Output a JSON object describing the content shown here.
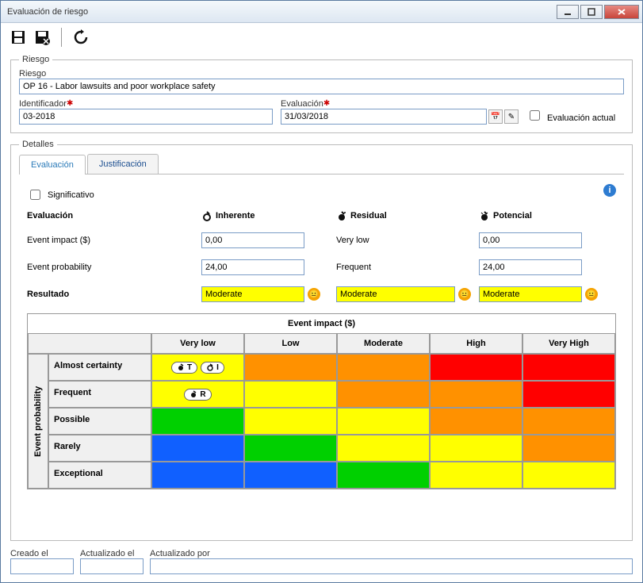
{
  "window": {
    "title": "Evaluación de riesgo"
  },
  "riesgo": {
    "legend": "Riesgo",
    "riesgo_label": "Riesgo",
    "riesgo_value": "OP 16 - Labor lawsuits and poor workplace safety",
    "identificador_label": "Identificador",
    "identificador_value": "03-2018",
    "evaluacion_label": "Evaluación",
    "evaluacion_value": "31/03/2018",
    "evaluacion_actual_label": "Evaluación actual"
  },
  "detalles": {
    "legend": "Detalles",
    "tabs": {
      "evaluacion": "Evaluación",
      "justificacion": "Justificación"
    },
    "significativo_label": "Significativo",
    "columns": {
      "evaluacion": "Evaluación",
      "inherente": "Inherente",
      "residual": "Residual",
      "potencial": "Potencial"
    },
    "rows": {
      "event_impact": "Event impact ($)",
      "event_probability": "Event probability",
      "resultado": "Resultado"
    },
    "values": {
      "impact_inherente": "0,00",
      "impact_residual": "Very low",
      "impact_potencial": "0,00",
      "prob_inherente": "24,00",
      "prob_residual": "Frequent",
      "prob_potencial": "24,00",
      "res_inherente": "Moderate",
      "res_residual": "Moderate",
      "res_potencial": "Moderate"
    }
  },
  "heatmap": {
    "x_title": "Event impact ($)",
    "y_title": "Event probability",
    "x_labels": [
      "Very low",
      "Low",
      "Moderate",
      "High",
      "Very High"
    ],
    "y_labels": [
      "Almost certainty",
      "Frequent",
      "Possible",
      "Rarely",
      "Exceptional"
    ],
    "colors": [
      [
        "yellow",
        "orange",
        "orange",
        "red",
        "red"
      ],
      [
        "yellow",
        "yellow",
        "orange",
        "orange",
        "red"
      ],
      [
        "green",
        "yellow",
        "yellow",
        "orange",
        "orange"
      ],
      [
        "blue",
        "green",
        "yellow",
        "yellow",
        "orange"
      ],
      [
        "blue",
        "blue",
        "green",
        "yellow",
        "yellow"
      ]
    ],
    "chips": {
      "0_0": [
        "T",
        "I"
      ],
      "1_0": [
        "R"
      ]
    }
  },
  "footer": {
    "creado_el": "Creado el",
    "actualizado_el": "Actualizado el",
    "actualizado_por": "Actualizado por"
  }
}
